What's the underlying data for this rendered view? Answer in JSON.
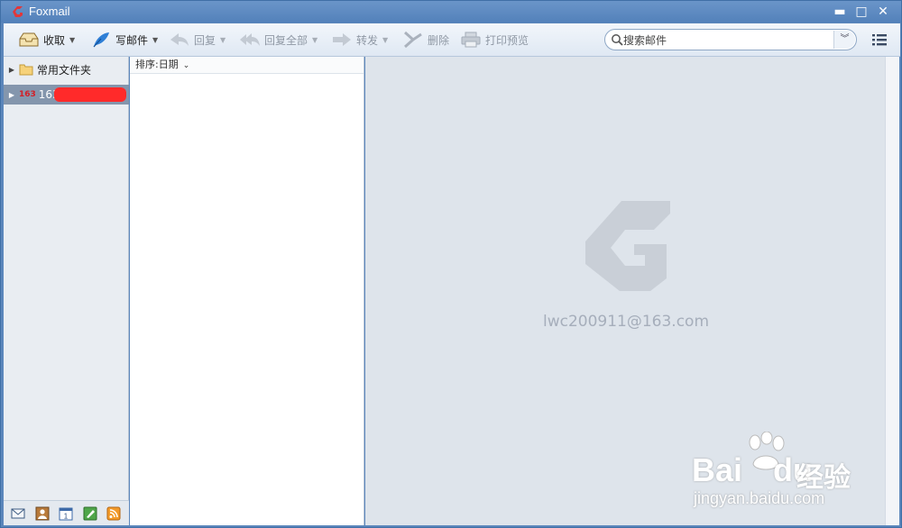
{
  "titlebar": {
    "title": "Foxmail",
    "minimize_glyph": "▬",
    "maximize_glyph": "□",
    "close_glyph": "✕"
  },
  "toolbar": {
    "receive": {
      "label": "收取",
      "icon": "inbox-tray-icon",
      "enabled": true
    },
    "compose": {
      "label": "写邮件",
      "icon": "quill-pen-icon",
      "enabled": true
    },
    "reply": {
      "label": "回复",
      "icon": "reply-arrow-icon",
      "enabled": false
    },
    "reply_all": {
      "label": "回复全部",
      "icon": "reply-all-arrow-icon",
      "enabled": false
    },
    "forward": {
      "label": "转发",
      "icon": "forward-arrow-icon",
      "enabled": false
    },
    "delete": {
      "label": "删除",
      "icon": "delete-icon",
      "enabled": false
    },
    "print_preview": {
      "label": "打印预览",
      "icon": "printer-icon",
      "enabled": false
    }
  },
  "search": {
    "placeholder": "搜索邮件",
    "value": ""
  },
  "folders": {
    "common": {
      "label": "常用文件夹",
      "icon": "folder-icon"
    },
    "account": {
      "label": "163",
      "badge": "163",
      "selected": true
    }
  },
  "maillist": {
    "sort_label": "排序:日期"
  },
  "reading_pane": {
    "account_email": "lwc200911@163.com"
  },
  "bottom_bar": {
    "icons": [
      "mail-icon",
      "contacts-icon",
      "calendar-icon",
      "notes-icon",
      "rss-icon"
    ]
  },
  "overlay": {
    "brand": "Bai",
    "brand_du": "du",
    "brand_cn": "经验",
    "url": "jingyan.baidu.com"
  },
  "colors": {
    "accent": "#5b86bb",
    "selection": "#8496ad",
    "reading_bg": "#dee4eb",
    "redaction": "#ff2a2a"
  }
}
